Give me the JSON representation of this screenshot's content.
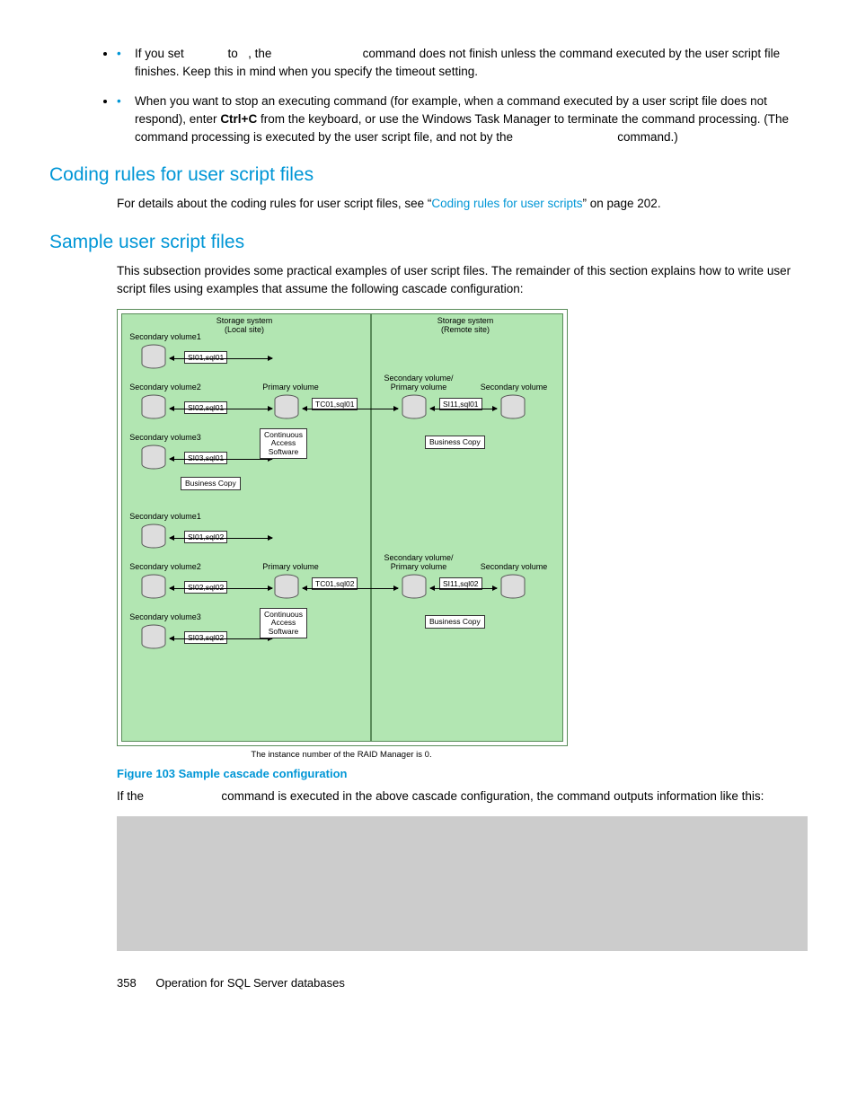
{
  "bullets": [
    {
      "pre": "If you set ",
      "mid1_gap": "            ",
      "mid1": "to ",
      "mid2_gap": "  ",
      "mid2": ", the ",
      "mid3_gap": "                          ",
      "post": "command does not finish unless the command executed by the user script file finishes. Keep this in mind when you specify the timeout setting."
    },
    {
      "text_a": "When you want to stop an executing command (for example, when a command executed by a user script file does not respond), enter ",
      "bold": "Ctrl+C",
      "text_b": " from the keyboard, or use the Windows Task Manager to terminate the command processing. (The command processing is executed by the user script file, and not by the ",
      "gap": "                              ",
      "text_c": "command.)"
    }
  ],
  "heading_coding": "Coding rules for user script files",
  "coding_para_a": "For details about the coding rules for user script files, see “",
  "coding_link": "Coding rules for user scripts",
  "coding_para_b": "” on page 202.",
  "heading_sample": "Sample user script files",
  "sample_para": "This subsection provides some practical examples of user script files. The remainder of this section explains how to write user script files using examples that assume the following cascade configuration:",
  "diagram": {
    "local_title": "Storage system\n(Local site)",
    "remote_title": "Storage system\n(Remote site)",
    "sv1": "Secondary volume1",
    "sv2": "Secondary volume2",
    "sv3": "Secondary volume3",
    "pv": "Primary volume",
    "svpv": "Secondary volume/\nPrimary volume",
    "sv": "Secondary volume",
    "si01_01": "SI01,sql01",
    "si02_01": "SI02,sql01",
    "si03_01": "SI03,sql01",
    "tc01_01": "TC01,sql01",
    "si11_01": "SI11,sql01",
    "si01_02": "SI01,sql02",
    "si02_02": "SI02,sql02",
    "si03_02": "SI03,sql02",
    "tc01_02": "TC01,sql02",
    "si11_02": "SI11,sql02",
    "cas": "Continuous\nAccess\nSoftware",
    "bc": "Business Copy"
  },
  "raid_note": "The instance number of the RAID Manager is 0.",
  "figure_caption": "Figure 103 Sample cascade configuration",
  "after_fig_a": "If the ",
  "after_fig_gap": "                      ",
  "after_fig_b": "command is executed in the above cascade configuration, the command outputs information like this:",
  "footer_page": "358",
  "footer_title": "Operation for SQL Server databases"
}
